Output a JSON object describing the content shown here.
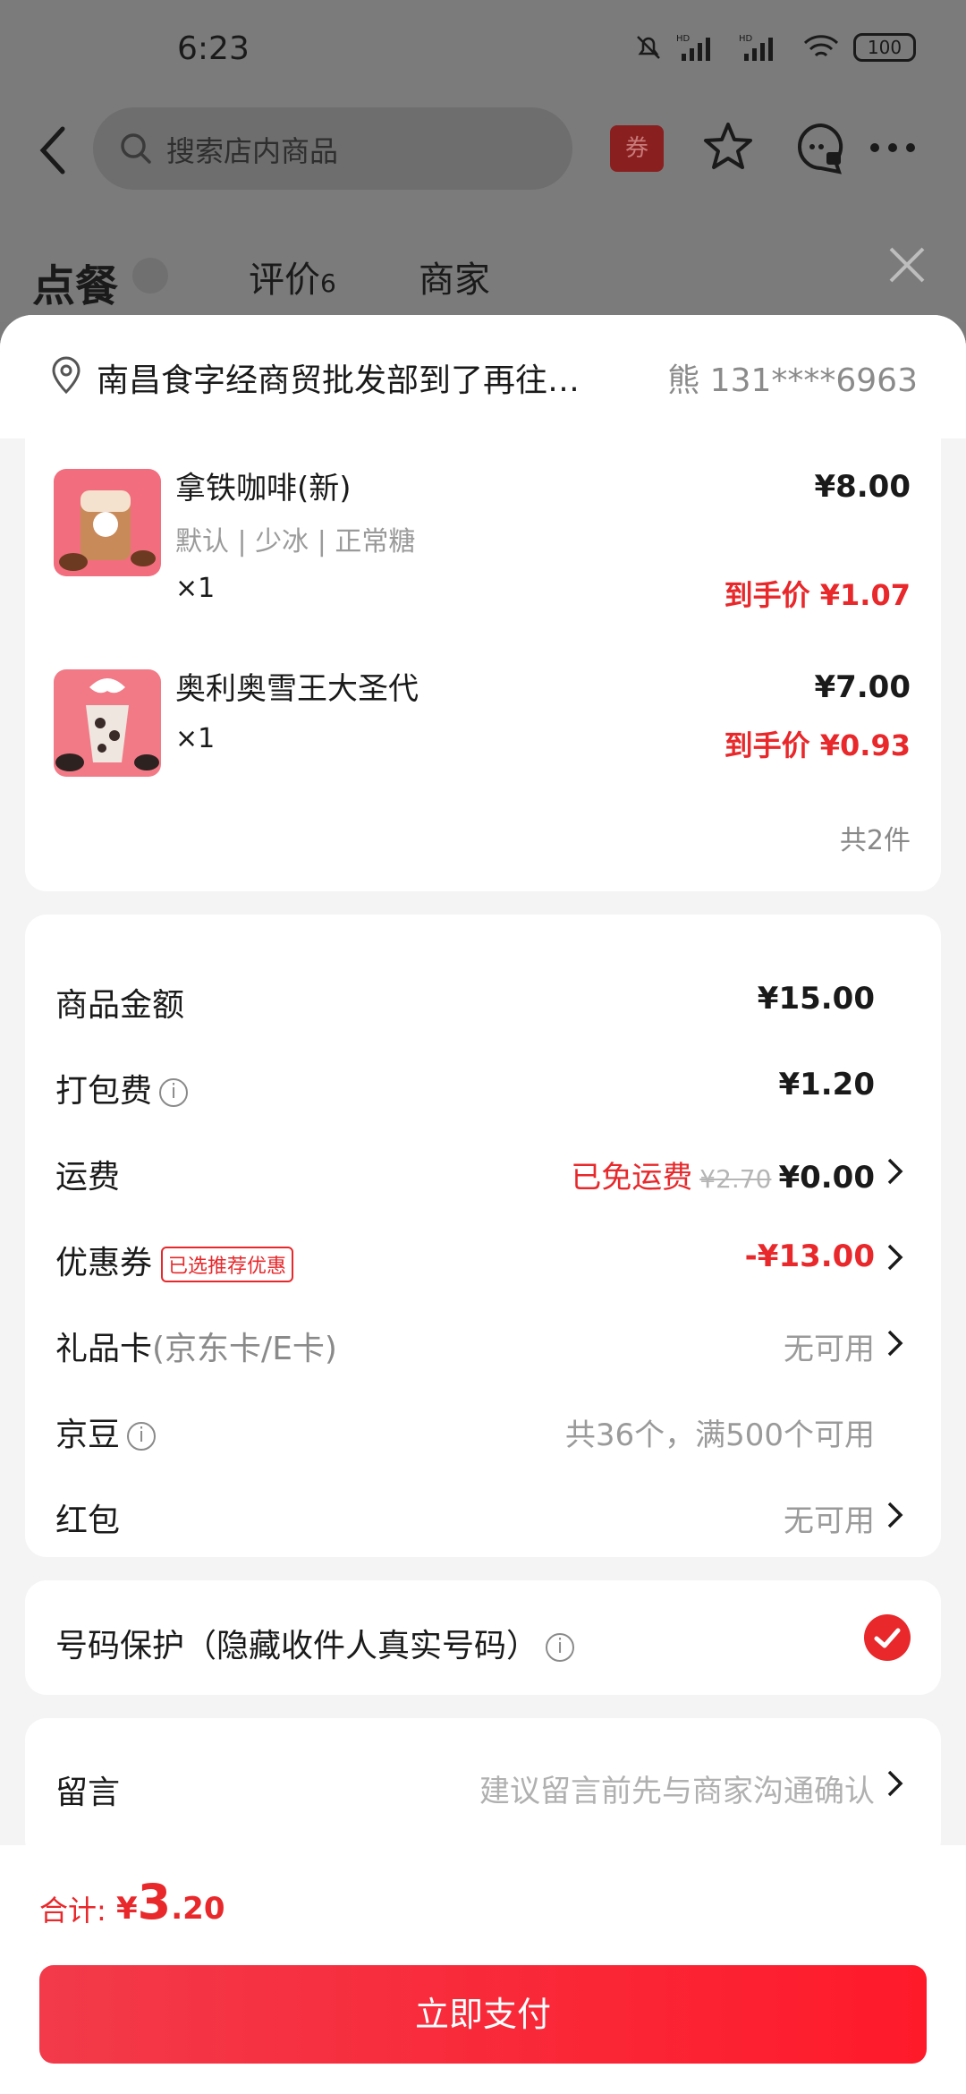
{
  "status": {
    "time": "6:23",
    "battery": "100"
  },
  "header": {
    "search_placeholder": "搜索店内商品",
    "coupon_label": "券"
  },
  "tabs": [
    {
      "label": "点餐"
    },
    {
      "label": "评价",
      "count": "6"
    },
    {
      "label": "商家"
    }
  ],
  "address": {
    "text": "南昌食字经商贸批发部到了再往…",
    "contact": "熊  131****6963"
  },
  "items": [
    {
      "name": "拿铁咖啡(新)",
      "spec": "默认 | 少冰 | 正常糖",
      "qty": "×1",
      "price": "¥8.00",
      "deal": "到手价 ¥1.07"
    },
    {
      "name": "奥利奥雪王大圣代",
      "spec": "",
      "qty": "×1",
      "price": "¥7.00",
      "deal": "到手价 ¥0.93"
    }
  ],
  "items_total": "共2件",
  "fees": {
    "goods_label": "商品金额",
    "goods_value": "¥15.00",
    "pack_label": "打包费",
    "pack_value": "¥1.20",
    "ship_label": "运费",
    "ship_free": "已免运费",
    "ship_original": "¥2.70",
    "ship_value": "¥0.00",
    "coupon_label": "优惠券",
    "coupon_tag": "已选推荐优惠",
    "coupon_value": "-¥13.00",
    "gift_label": "礼品卡",
    "gift_sub": "(京东卡/E卡)",
    "gift_value": "无可用",
    "bean_label": "京豆",
    "bean_value": "共36个，满500个可用",
    "redpack_label": "红包",
    "redpack_value": "无可用"
  },
  "privacy": {
    "label": "号码保护（隐藏收件人真实号码）",
    "checked": true
  },
  "message": {
    "label": "留言",
    "placeholder": "建议留言前先与商家沟通确认"
  },
  "footer": {
    "total_label": "合计:",
    "currency": "¥",
    "total_int": "3",
    "total_dec": ".20",
    "pay_label": "立即支付"
  },
  "colors": {
    "accent": "#e8282b",
    "pay_button": "#f5283a"
  }
}
